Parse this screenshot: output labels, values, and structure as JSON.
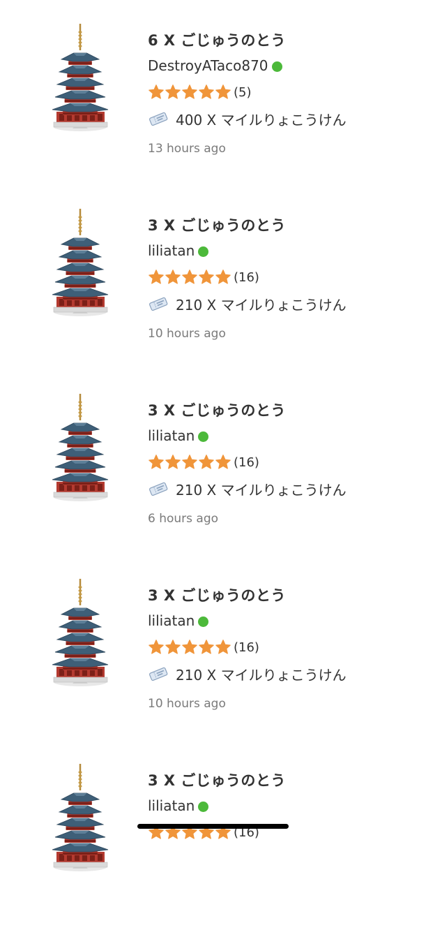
{
  "colors": {
    "online": "#4cb93a",
    "star": "#f0953a",
    "text": "#333333",
    "muted": "#7a7a7a"
  },
  "icons": {
    "item": "pagoda-icon",
    "price": "ticket-icon",
    "rating": "star-icon"
  },
  "listings": [
    {
      "title": "6 X ごじゅうのとう",
      "seller": "DestroyATaco870",
      "online": true,
      "stars": 5,
      "rating_count": "(5)",
      "price": "400 X マイルりょこうけん",
      "time": "13 hours ago"
    },
    {
      "title": "3 X ごじゅうのとう",
      "seller": "liliatan",
      "online": true,
      "stars": 5,
      "rating_count": "(16)",
      "price": "210 X マイルりょこうけん",
      "time": "10 hours ago"
    },
    {
      "title": "3 X ごじゅうのとう",
      "seller": "liliatan",
      "online": true,
      "stars": 5,
      "rating_count": "(16)",
      "price": "210 X マイルりょこうけん",
      "time": "6 hours ago"
    },
    {
      "title": "3 X ごじゅうのとう",
      "seller": "liliatan",
      "online": true,
      "stars": 5,
      "rating_count": "(16)",
      "price": "210 X マイルりょこうけん",
      "time": "10 hours ago"
    },
    {
      "title": "3 X ごじゅうのとう",
      "seller": "liliatan",
      "online": true,
      "stars": 5,
      "rating_count": "(16)",
      "price": "",
      "time": ""
    }
  ]
}
